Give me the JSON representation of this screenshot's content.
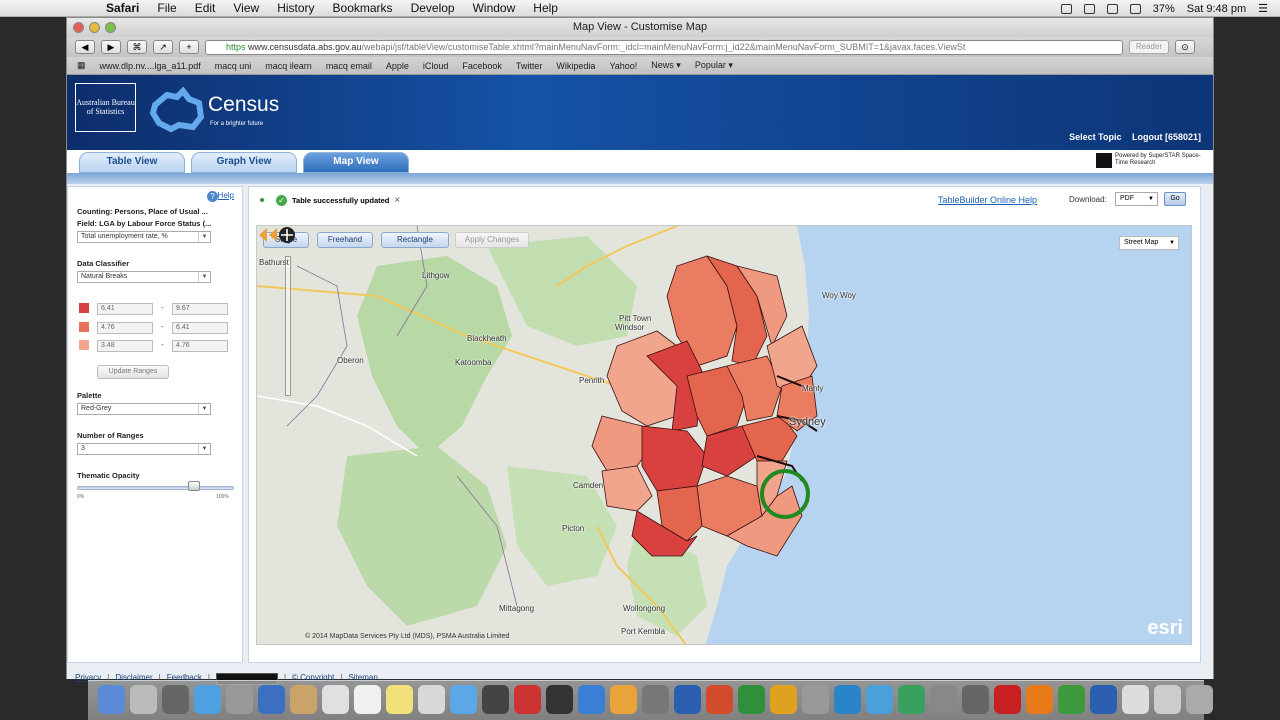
{
  "menubar": {
    "app": "Safari",
    "items": [
      "File",
      "Edit",
      "View",
      "History",
      "Bookmarks",
      "Develop",
      "Window",
      "Help"
    ],
    "battery": "37%",
    "clock": "Sat 9:48 pm"
  },
  "window": {
    "title": "Map View - Customise Map",
    "url_scheme": "https",
    "url_host": "www.censusdata.abs.gov.au",
    "url_path": "/webapi/jsf/tableView/customiseTable.xhtml?mainMenuNavForm:_idcl=mainMenuNavForm:j_id22&mainMenuNavForm_SUBMIT=1&javax.faces.ViewSt",
    "reader": "Reader",
    "bookmarks": [
      "www.dlp.nv....lga_a11.pdf",
      "macq uni",
      "macq ilearn",
      "macq email",
      "Apple",
      "iCloud",
      "Facebook",
      "Twitter",
      "Wikipedia",
      "Yahoo!",
      "News ▾",
      "Popular ▾"
    ]
  },
  "banner": {
    "abs_logo": "Australian Bureau of Statistics",
    "census_word": "Census",
    "census_tag": "For a brighter future",
    "select_topic": "Select Topic",
    "logout": "Logout [658021]"
  },
  "tabs": [
    "Table View",
    "Graph View",
    "Map View"
  ],
  "superstar": "Powered by SuperSTAR Space-Time Research",
  "left": {
    "help": "Help",
    "counting": "Counting: Persons, Place of Usual ...",
    "field": "Field: LGA by Labour Force Status (...",
    "field_select": "Total unemployment rate, %",
    "classifier_label": "Data Classifier",
    "classifier_value": "Natural Breaks",
    "ranges": [
      {
        "color": "#d94040",
        "min": "6.41",
        "max": "9.67"
      },
      {
        "color": "#e8735a",
        "min": "4.76",
        "max": "6.41"
      },
      {
        "color": "#f0a58c",
        "min": "3.48",
        "max": "4.76"
      }
    ],
    "update_ranges": "Update Ranges",
    "palette_label": "Palette",
    "palette_value": "Red-Grey",
    "num_ranges_label": "Number of Ranges",
    "num_ranges_value": "3",
    "opacity_label": "Thematic Opacity",
    "opacity_min": "0%",
    "opacity_max": "100%",
    "opacity_value": 0.8
  },
  "right": {
    "status": "Table successfully updated",
    "help_link": "TableBuilder Online Help",
    "download_label": "Download:",
    "download_format": "PDF",
    "go": "Go",
    "map_tools": [
      "Single",
      "Freehand",
      "Rectangle",
      "Apply Changes"
    ],
    "basemap": "Street Map",
    "places": [
      "Lithgow",
      "Pitt Town",
      "Windsor",
      "Blackheath",
      "Katoomba",
      "Oberon",
      "Penrith",
      "Sydney",
      "Manly",
      "Camden",
      "Picton",
      "Wollongong",
      "Port Kembla",
      "Mittagong",
      "Bathurst",
      "Woy Woy"
    ],
    "copyright": "© 2014 MapData Services Pty Ltd (MDS), PSMA Australia Limited",
    "esri": "esri"
  },
  "footer": [
    "Privacy",
    "Disclaimer",
    "Feedback",
    "© Copyright",
    "Sitemap"
  ]
}
